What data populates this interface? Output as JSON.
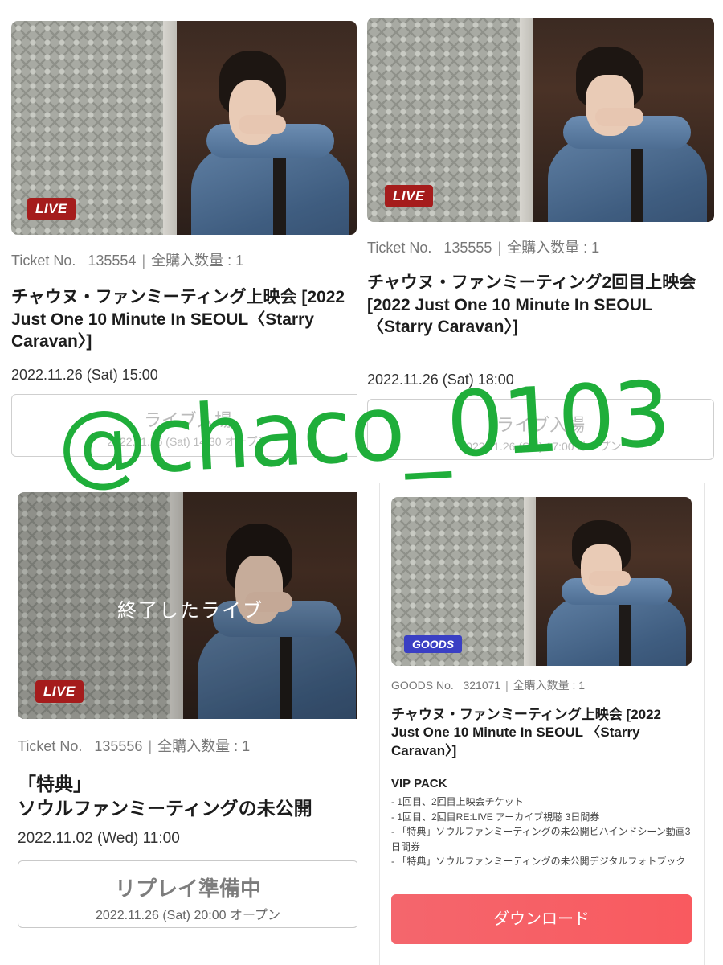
{
  "panel1": {
    "badge": "LIVE",
    "ticket_label": "Ticket No.",
    "ticket_no": "135554",
    "qty_label": "全購入数量 : 1",
    "title": "チャウヌ・ファンミーティング上映会 [2022 Just One 10 Minute In SEOUL〈Starry Caravan〉]",
    "datetime": "2022.11.26 (Sat) 15:00",
    "button_main": "ライブ入場",
    "button_sub": "2022.11.26 (Sat) 14:30 オープン"
  },
  "panel2": {
    "badge": "LIVE",
    "ticket_label": "Ticket No.",
    "ticket_no": "135555",
    "qty_label": "全購入数量 : 1",
    "title": "チャウヌ・ファンミーティング2回目上映会 [2022 Just One 10 Minute In SEOUL 〈Starry Caravan〉]",
    "datetime": "2022.11.26 (Sat) 18:00",
    "button_main": "ライブ入場",
    "button_sub": "2022.11.26 (Sat) 17:00 オープン"
  },
  "panel3": {
    "badge": "LIVE",
    "overlay_text": "終了したライブ",
    "ticket_label": "Ticket No.",
    "ticket_no": "135556",
    "qty_label": "全購入数量 : 1",
    "title_line1": "「特典」",
    "title_line2": "ソウルファンミーティングの未公開",
    "datetime": "2022.11.02 (Wed) 11:00",
    "button_main": "リプレイ準備中",
    "button_sub": "2022.11.26 (Sat) 20:00 オープン"
  },
  "panel4": {
    "badge": "GOODS",
    "goods_label": "GOODS No.",
    "goods_no": "321071",
    "qty_label": "全購入数量 : 1",
    "title": "チャウヌ・ファンミーティング上映会 [2022 Just One 10 Minute In SEOUL 〈Starry Caravan〉]",
    "vip_heading": "VIP PACK",
    "vip_items": [
      "- 1回目、2回目上映会チケット",
      "- 1回目、2回目RE:LIVE アーカイブ視聴 3日間券",
      "- 「特典」ソウルファンミーティングの未公開ビハインドシーン動画3日間券",
      "- 「特典」ソウルファンミーティングの未公開デジタルフォトブック"
    ],
    "download_label": "ダウンロード"
  },
  "watermark": "@chaco_0103",
  "colors": {
    "live_badge": "#a51c1c",
    "goods_badge": "#3a3fc4",
    "download_button": "#f95a5f",
    "watermark": "#1fae3a"
  }
}
